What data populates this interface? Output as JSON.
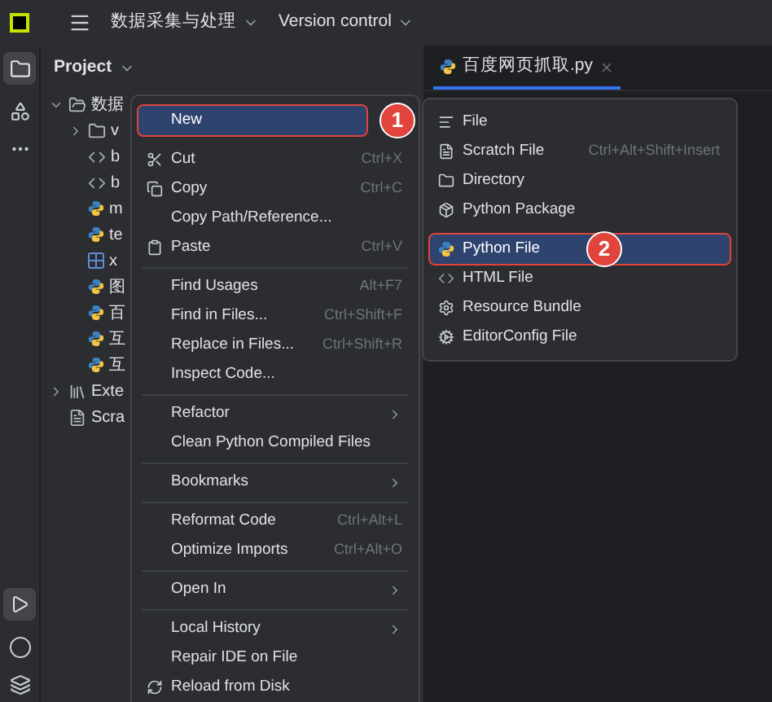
{
  "toolbar": {
    "project_switcher": "数据采集与处理",
    "vcs": "Version control"
  },
  "project_panel": {
    "title": "Project",
    "tree": [
      {
        "label": "数据",
        "kind": "folder",
        "expanded": true,
        "children": [
          {
            "label": "v",
            "kind": "folder",
            "expanded": false
          },
          {
            "label": "b",
            "kind": "html"
          },
          {
            "label": "b",
            "kind": "html"
          },
          {
            "label": "m",
            "kind": "python"
          },
          {
            "label": "te",
            "kind": "python"
          },
          {
            "label": "x",
            "kind": "xml"
          },
          {
            "label": "图",
            "kind": "python"
          },
          {
            "label": "百",
            "kind": "python"
          },
          {
            "label": "互",
            "kind": "python"
          },
          {
            "label": "互",
            "kind": "python"
          }
        ]
      },
      {
        "label": "Exte",
        "kind": "library",
        "expanded": false
      },
      {
        "label": "Scra",
        "kind": "scratch"
      }
    ]
  },
  "editor_tabs": [
    {
      "label": "百度网页抓取.py",
      "selected": true
    }
  ],
  "context_menu": [
    {
      "kind": "item",
      "label": "New",
      "selected": true,
      "callout": "1"
    },
    {
      "kind": "gap"
    },
    {
      "kind": "item",
      "label": "Cut",
      "shortcut": "Ctrl+X",
      "selected": false
    },
    {
      "kind": "item",
      "label": "Copy",
      "shortcut": "Ctrl+C",
      "selected": false
    },
    {
      "kind": "item",
      "label": "Copy Path/Reference...",
      "selected": false
    },
    {
      "kind": "item",
      "label": "Paste",
      "shortcut": "Ctrl+V",
      "selected": false
    },
    {
      "kind": "separator"
    },
    {
      "kind": "item",
      "label": "Find Usages",
      "shortcut": "Alt+F7",
      "selected": false
    },
    {
      "kind": "item",
      "label": "Find in Files...",
      "shortcut": "Ctrl+Shift+F",
      "selected": false
    },
    {
      "kind": "item",
      "label": "Replace in Files...",
      "shortcut": "Ctrl+Shift+R",
      "selected": false
    },
    {
      "kind": "item",
      "label": "Inspect Code...",
      "selected": false
    },
    {
      "kind": "separator"
    },
    {
      "kind": "item",
      "label": "Refactor",
      "submenu": true,
      "selected": false
    },
    {
      "kind": "item",
      "label": "Clean Python Compiled Files",
      "selected": false
    },
    {
      "kind": "separator"
    },
    {
      "kind": "item",
      "label": "Bookmarks",
      "submenu": true,
      "selected": false
    },
    {
      "kind": "separator"
    },
    {
      "kind": "item",
      "label": "Reformat Code",
      "shortcut": "Ctrl+Alt+L",
      "selected": false
    },
    {
      "kind": "item",
      "label": "Optimize Imports",
      "shortcut": "Ctrl+Alt+O",
      "selected": false
    },
    {
      "kind": "separator"
    },
    {
      "kind": "item",
      "label": "Open In",
      "submenu": true,
      "selected": false
    },
    {
      "kind": "separator"
    },
    {
      "kind": "item",
      "label": "Local History",
      "submenu": true,
      "selected": false
    },
    {
      "kind": "item",
      "label": "Repair IDE on File",
      "selected": false
    },
    {
      "kind": "item",
      "label": "Reload from Disk",
      "selected": false
    }
  ],
  "new_submenu": [
    {
      "kind": "item",
      "label": "File",
      "selected": false
    },
    {
      "kind": "item",
      "label": "Scratch File",
      "shortcut": "Ctrl+Alt+Shift+Insert",
      "selected": false
    },
    {
      "kind": "item",
      "label": "Directory",
      "selected": false
    },
    {
      "kind": "item",
      "label": "Python Package",
      "selected": false
    },
    {
      "kind": "gap"
    },
    {
      "kind": "item",
      "label": "Python File",
      "selected": true,
      "callout": "2"
    },
    {
      "kind": "item",
      "label": "HTML File",
      "selected": false
    },
    {
      "kind": "item",
      "label": "Resource Bundle",
      "selected": false
    },
    {
      "kind": "item",
      "label": "EditorConfig File",
      "selected": false
    }
  ]
}
